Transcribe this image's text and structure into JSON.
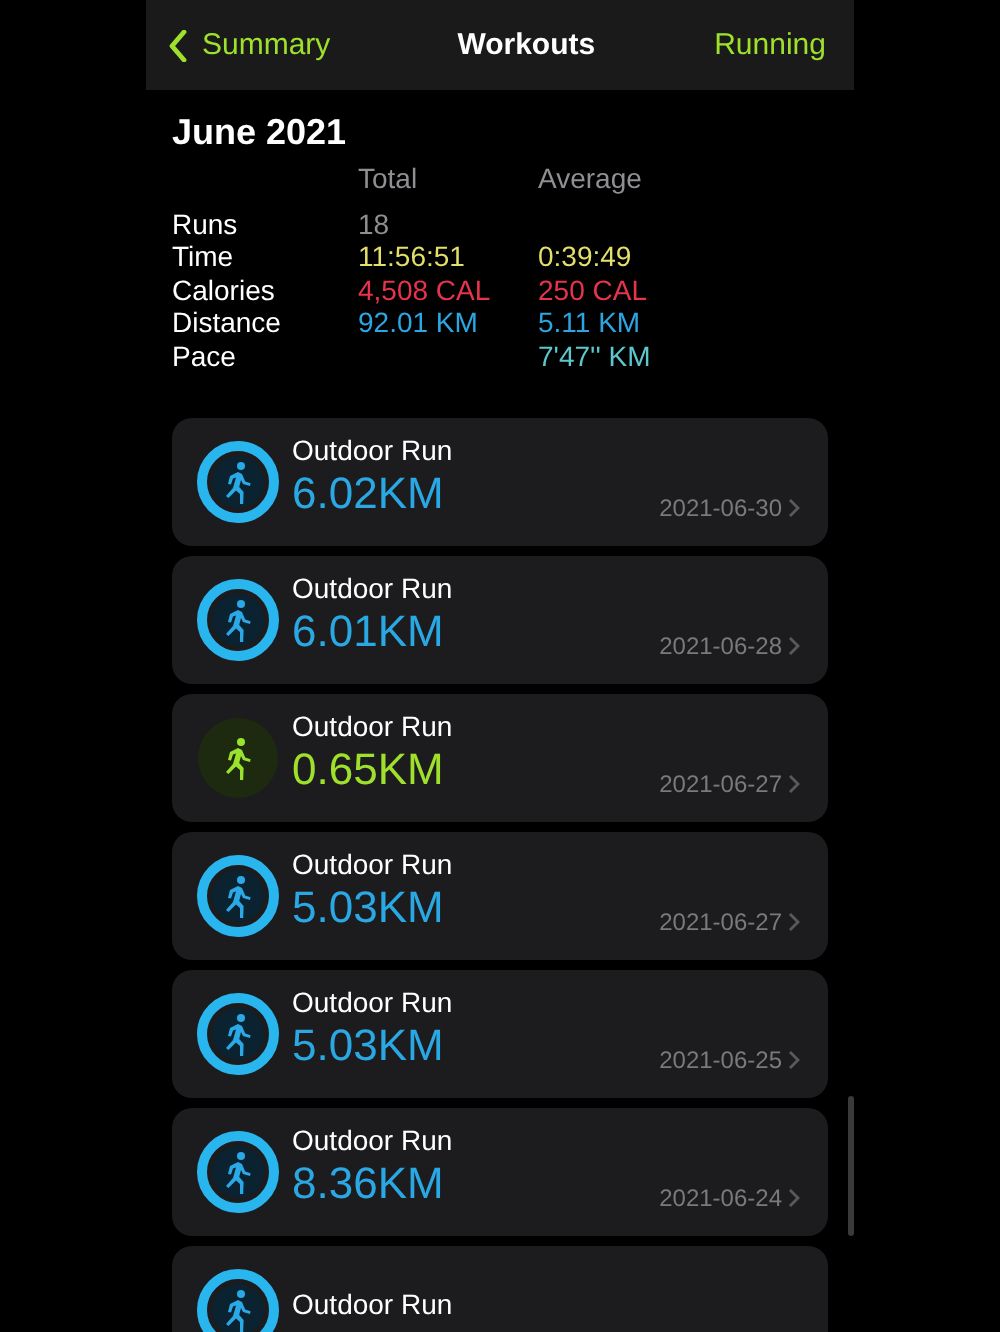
{
  "nav": {
    "back": "Summary",
    "title": "Workouts",
    "action": "Running"
  },
  "summary": {
    "heading": "June 2021",
    "columns": [
      "Total",
      "Average"
    ],
    "rows": [
      {
        "kind": "count",
        "label": "Runs",
        "total": "18"
      },
      {
        "kind": "time",
        "label": "Time",
        "total": "11:56:51",
        "average": "0:39:49"
      },
      {
        "kind": "calories",
        "label": "Calories",
        "total": "4,508 CAL",
        "average": "250 CAL"
      },
      {
        "kind": "distance",
        "label": "Distance",
        "total": "92.01 KM",
        "average": "5.11 KM"
      },
      {
        "kind": "pace",
        "label": "Pace",
        "average": "7'47'' KM"
      }
    ]
  },
  "workouts": [
    {
      "kind": "ring",
      "name": "Outdoor Run",
      "distance": "6.02KM",
      "date": "2021-06-30"
    },
    {
      "kind": "ring",
      "name": "Outdoor Run",
      "distance": "6.01KM",
      "date": "2021-06-28"
    },
    {
      "kind": "plain",
      "name": "Outdoor Run",
      "distance": "0.65KM",
      "date": "2021-06-27"
    },
    {
      "kind": "ring",
      "name": "Outdoor Run",
      "distance": "5.03KM",
      "date": "2021-06-27"
    },
    {
      "kind": "ring",
      "name": "Outdoor Run",
      "distance": "5.03KM",
      "date": "2021-06-25"
    },
    {
      "kind": "ring",
      "name": "Outdoor Run",
      "distance": "8.36KM",
      "date": "2021-06-24"
    },
    {
      "kind": "ring",
      "name": "Outdoor Run"
    }
  ]
}
